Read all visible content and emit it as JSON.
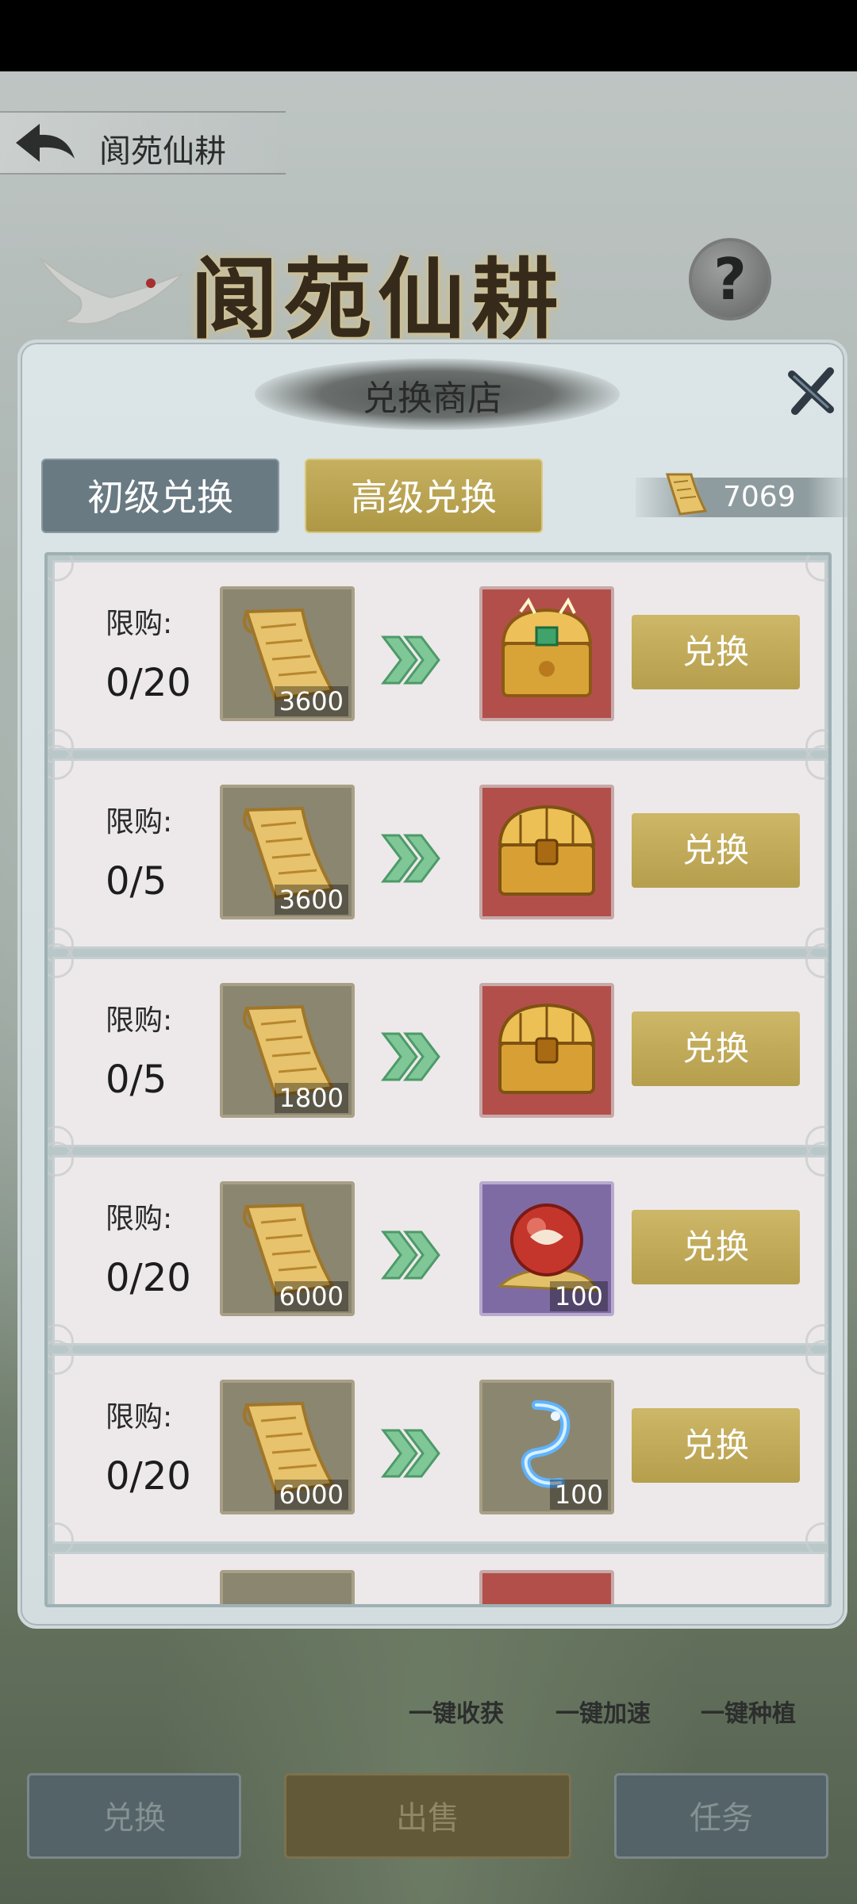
{
  "page_title": "阆苑仙耕",
  "banner_title": "阆苑仙耕",
  "help_label": "?",
  "modal": {
    "title": "兑换商店",
    "tabs": [
      {
        "label": "初级兑换",
        "active": false
      },
      {
        "label": "高级兑换",
        "active": true
      }
    ],
    "currency": {
      "icon": "scroll-icon",
      "value": "7069"
    }
  },
  "items": [
    {
      "limit_label": "限购:",
      "limit_value": "0/20",
      "cost": "3600",
      "cost_icon": "scroll-icon",
      "reward_icon": "jeweled-chest-icon",
      "reward_bg": "red",
      "reward_qty": "",
      "button": "兑换"
    },
    {
      "limit_label": "限购:",
      "limit_value": "0/5",
      "cost": "3600",
      "cost_icon": "scroll-icon",
      "reward_icon": "gold-chest-icon",
      "reward_bg": "red",
      "reward_qty": "",
      "button": "兑换"
    },
    {
      "limit_label": "限购:",
      "limit_value": "0/5",
      "cost": "1800",
      "cost_icon": "scroll-icon",
      "reward_icon": "gold-chest-icon",
      "reward_bg": "red",
      "reward_qty": "",
      "button": "兑换"
    },
    {
      "limit_label": "限购:",
      "limit_value": "0/20",
      "cost": "6000",
      "cost_icon": "scroll-icon",
      "reward_icon": "red-orb-icon",
      "reward_bg": "purple",
      "reward_qty": "100",
      "button": "兑换"
    },
    {
      "limit_label": "限购:",
      "limit_value": "0/20",
      "cost": "6000",
      "cost_icon": "scroll-icon",
      "reward_icon": "blue-dragon-spirit-icon",
      "reward_bg": "grey",
      "reward_qty": "100",
      "button": "兑换"
    }
  ],
  "quick_actions": [
    "一键收获",
    "一键加速",
    "一键种植"
  ],
  "bottom_nav": [
    {
      "label": "兑换"
    },
    {
      "label": "出售"
    },
    {
      "label": "任务"
    }
  ],
  "colors": {
    "gold_button": "#c3ad5c",
    "tab_inactive": "#6a7a83",
    "modal_bg": "#d7e0e2"
  }
}
